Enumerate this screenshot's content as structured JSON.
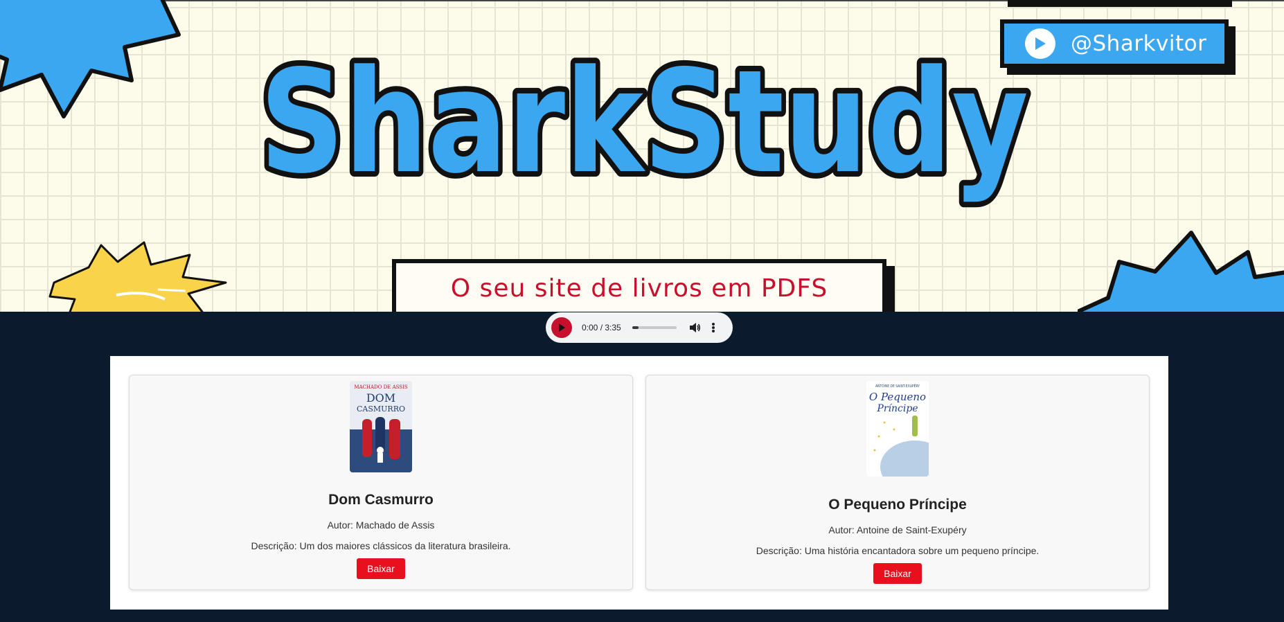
{
  "banner": {
    "channel_handle": "@Sharkvitor",
    "logo": "SharkStudy",
    "tagline": "O seu site de livros em PDFS",
    "accent_color": "#3aa7f0",
    "tagline_color": "#c8102e"
  },
  "audio": {
    "time": "0:00 / 3:35",
    "progress_fraction": 0.0,
    "play_color": "#c8102e"
  },
  "books": [
    {
      "cover_top_text": "MACHADO DE ASSIS",
      "cover_title_line1": "DOM",
      "cover_title_line2": "CASMURRO",
      "title": "Dom Casmurro",
      "author": "Autor: Machado de Assis",
      "description": "Descrição: Um dos maiores clássicos da literatura brasileira.",
      "button_label": "Baixar"
    },
    {
      "cover_top_text": "ANTOINE DE SAINT-EXUPÉRY",
      "cover_title_line1": "O Pequeno",
      "cover_title_line2": "Príncipe",
      "title": "O Pequeno Príncipe",
      "author": "Autor: Antoine de Saint-Exupéry",
      "description": "Descrição: Uma história encantadora sobre um pequeno príncipe.",
      "button_label": "Baixar"
    }
  ],
  "colors": {
    "page_background": "#0c1a2e",
    "button": "#e8101e"
  }
}
